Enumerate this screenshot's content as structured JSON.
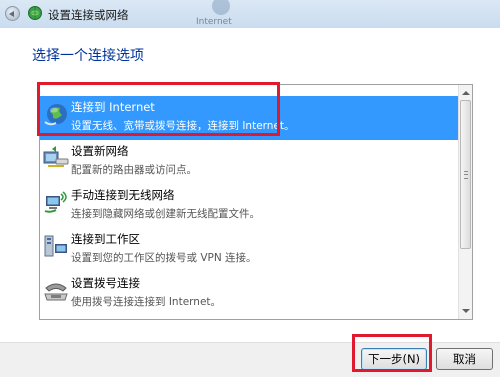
{
  "window": {
    "title": "设置连接或网络",
    "background_label": "Internet"
  },
  "page_title": "选择一个连接选项",
  "options": [
    {
      "name": "连接到 Internet",
      "desc": "设置无线、宽带或拨号连接，连接到 Internet。",
      "icon": "globe-icon",
      "selected": true
    },
    {
      "name": "设置新网络",
      "desc": "配置新的路由器或访问点。",
      "icon": "router-icon",
      "selected": false
    },
    {
      "name": "手动连接到无线网络",
      "desc": "连接到隐藏网络或创建新无线配置文件。",
      "icon": "wireless-computer-icon",
      "selected": false
    },
    {
      "name": "连接到工作区",
      "desc": "设置到您的工作区的拨号或 VPN 连接。",
      "icon": "workplace-icon",
      "selected": false
    },
    {
      "name": "设置拨号连接",
      "desc": "使用拨号连接连接到 Internet。",
      "icon": "phone-icon",
      "selected": false
    }
  ],
  "buttons": {
    "next": "下一步(N)",
    "cancel": "取消"
  },
  "colors": {
    "selection": "#3399ff",
    "title_blue": "#003399",
    "highlight_red": "#e0192e"
  }
}
